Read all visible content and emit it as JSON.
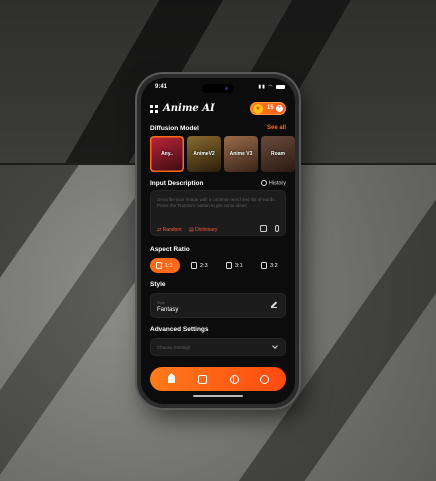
{
  "status": {
    "time": "9:41"
  },
  "app": {
    "title": "Anime AI",
    "credits": "15"
  },
  "diffusion": {
    "title": "Diffusion Model",
    "see_all": "See all",
    "models": [
      {
        "label": "Any..",
        "color1": "#c0263a",
        "color2": "#3a0a12",
        "active": true
      },
      {
        "label": "AnimeV2",
        "color1": "#8a6a30",
        "color2": "#2a1e0c",
        "active": false
      },
      {
        "label": "Anime V3",
        "color1": "#9a6a4a",
        "color2": "#3a2418",
        "active": false
      },
      {
        "label": "Roam",
        "color1": "#6a4a3a",
        "color2": "#2a1a14",
        "active": false
      }
    ]
  },
  "input": {
    "title": "Input Description",
    "history": "History",
    "placeholder": "Describe your image with a common word and list of words. Press the 'Random' button to get some ideas",
    "random": "Random",
    "dictionary": "Dictionary"
  },
  "aspect": {
    "title": "Aspect Ratio",
    "options": [
      "1:1",
      "2:3",
      "3:1",
      "3:2"
    ]
  },
  "style": {
    "title": "Style",
    "label": "Style",
    "value": "Fantasy"
  },
  "advanced": {
    "title": "Advanced Settings",
    "placeholder": "Choose Settings"
  },
  "colors": {
    "accent": "#ff6a1a"
  },
  "nav": {
    "icons": [
      "home-icon",
      "generate-icon",
      "globe-icon",
      "user-icon"
    ]
  }
}
